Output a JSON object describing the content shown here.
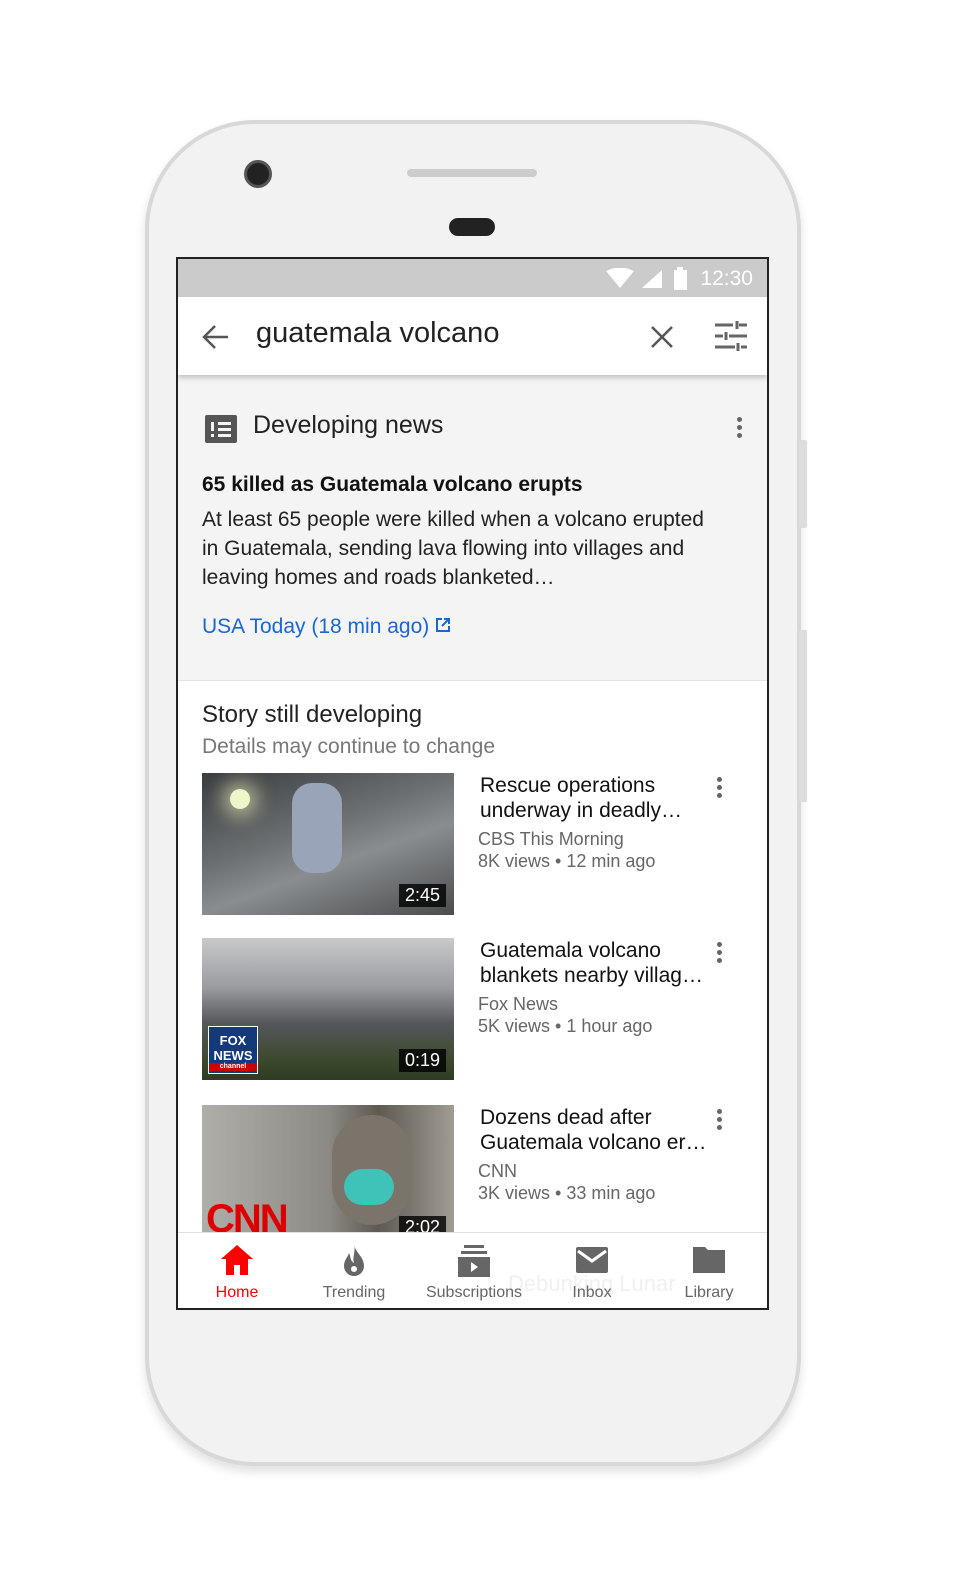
{
  "status": {
    "time": "12:30"
  },
  "search": {
    "query": "guatemala volcano",
    "icons": [
      "back-arrow-icon",
      "close-icon",
      "filter-icon"
    ]
  },
  "news": {
    "header": "Developing news",
    "title": "65 killed as Guatemala volcano erupts",
    "body": "At least 65 people were killed when a volcano erupted in Guatemala, sending lava flowing into villages and leaving homes and roads blanketed…",
    "source": "USA Today (18 min ago)"
  },
  "story": {
    "title": "Story still developing",
    "subtitle": "Details may continue to change"
  },
  "videos": [
    {
      "title": "Rescue operations underway in deadly…",
      "channel": "CBS This Morning",
      "meta": "8K views • 12 min ago",
      "duration": "2:45"
    },
    {
      "title": "Guatemala volcano blankets nearby villag…",
      "channel": "Fox News",
      "meta": "5K views • 1 hour ago",
      "duration": "0:19",
      "logo": "FOX NEWS channel"
    },
    {
      "title": "Dozens dead after Guatemala volcano er…",
      "channel": "CNN",
      "meta": "3K views • 33 min ago",
      "duration": "2:02",
      "logo": "CNN"
    }
  ],
  "nav": {
    "items": [
      {
        "label": "Home",
        "active": true
      },
      {
        "label": "Trending"
      },
      {
        "label": "Subscriptions"
      },
      {
        "label": "Inbox"
      },
      {
        "label": "Library"
      }
    ],
    "ghost_text": "Debunking Lunar"
  },
  "colors": {
    "accent": "#ff0000",
    "link": "#1a66d4"
  }
}
